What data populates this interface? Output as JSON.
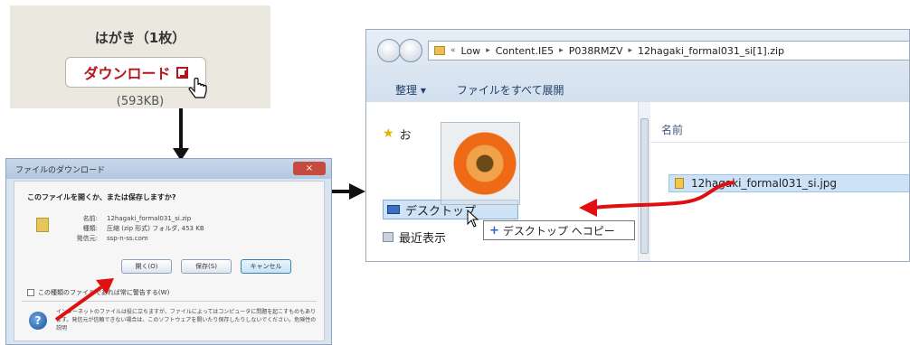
{
  "download_panel": {
    "title": "はがき（1枚）",
    "button_label": "ダウンロード",
    "file_size": "(593KB)"
  },
  "dialog": {
    "title": "ファイルのダウンロード",
    "close_label": "×",
    "question": "このファイルを開くか、または保存しますか?",
    "info_rows": [
      {
        "key": "名前:",
        "value": "12hagaki_formal031_si.zip"
      },
      {
        "key": "種類:",
        "value": "圧縮 (zip 形式) フォルダ, 453 KB"
      },
      {
        "key": "発信元:",
        "value": "ssp-n-ss.com"
      }
    ],
    "buttons": [
      "開く(O)",
      "保存(S)",
      "キャンセル"
    ],
    "checkbox_label": "この種類のファイルであれば常に警告する(W)",
    "warning": "インターネットのファイルは役に立ちますが、ファイルによってはコンピュータに問題を起こすものもあります。発信元が信頼できない場合は、このソフトウェアを開いたり保存したりしないでください。危険性の説明"
  },
  "explorer": {
    "breadcrumb": [
      "Low",
      "Content.IE5",
      "P038RMZV",
      "12hagaki_formal031_si[1].zip"
    ],
    "breadcrumb_prefix": "«",
    "toolbar": {
      "organize": "整理 ▾",
      "extract_all": "ファイルをすべて展開"
    },
    "nav": {
      "favorites": "お",
      "desktop": "デスクトップ",
      "recent": "最近表示"
    },
    "column_name": "名前",
    "file_name": "12hagaki_formal031_si.jpg",
    "copy_tooltip": "デスクトップ へコピー",
    "copy_plus": "+"
  },
  "colors": {
    "accent_red": "#e01010",
    "arrow_black": "#111111"
  }
}
